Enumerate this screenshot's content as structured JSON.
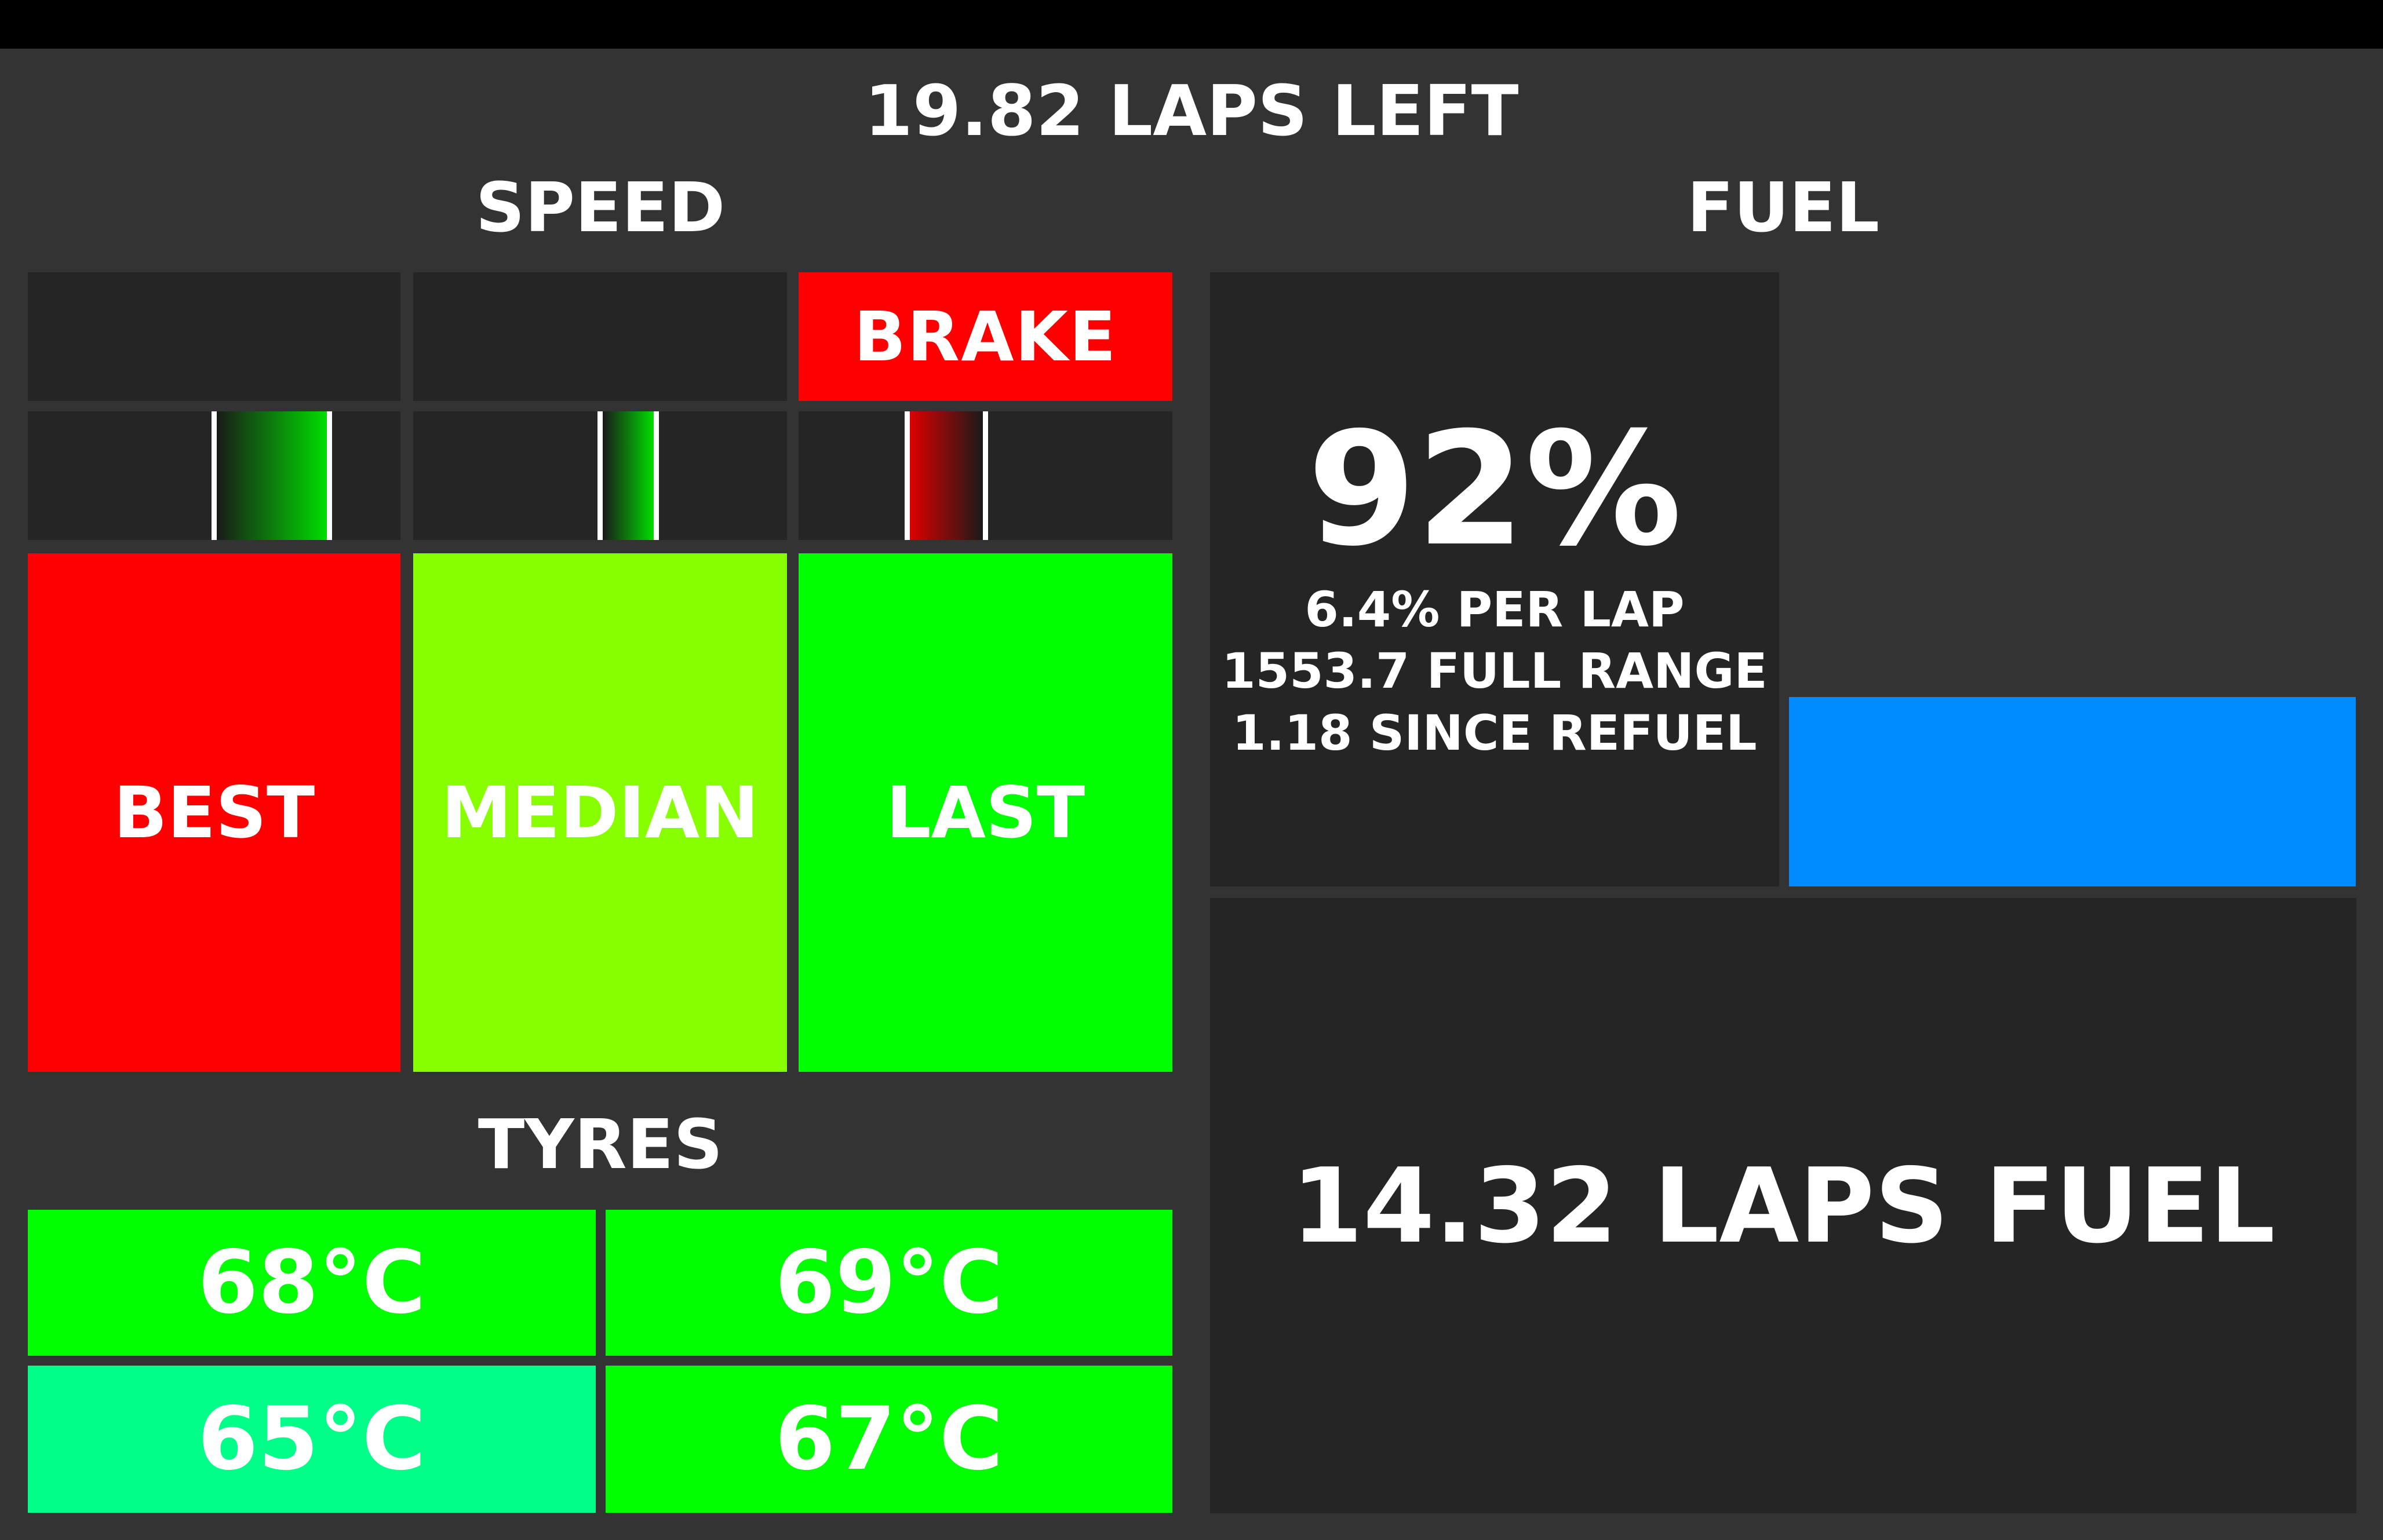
{
  "header": {
    "laps_left": "19.82 LAPS LEFT"
  },
  "speed": {
    "title": "SPEED",
    "indicators": [
      {
        "label": "",
        "color": "#252525"
      },
      {
        "label": "",
        "color": "#252525"
      },
      {
        "label": "BRAKE",
        "color": "#ff0000"
      }
    ],
    "delta_bars": [
      {
        "name": "best",
        "fill_color": "#00dd00",
        "direction": "positive",
        "level": 0.62
      },
      {
        "name": "median",
        "fill_color": "#00dd00",
        "direction": "positive",
        "level": 0.3
      },
      {
        "name": "last",
        "fill_color": "#dd0000",
        "direction": "negative",
        "level": 0.42
      }
    ],
    "boxes": [
      {
        "label": "BEST",
        "color": "#ff0000"
      },
      {
        "label": "MEDIAN",
        "color": "#88ff00"
      },
      {
        "label": "LAST",
        "color": "#00ff00"
      }
    ]
  },
  "tyres": {
    "title": "TYRES",
    "values": [
      {
        "label": "68°C",
        "color": "#00ff00"
      },
      {
        "label": "69°C",
        "color": "#00ff00"
      },
      {
        "label": "65°C",
        "color": "#00ff88"
      },
      {
        "label": "67°C",
        "color": "#00ff00"
      }
    ]
  },
  "fuel": {
    "title": "FUEL",
    "percent": "92%",
    "per_lap": "6.4% PER LAP",
    "full_range": "1553.7 FULL RANGE",
    "since_refuel": "1.18 SINCE REFUEL",
    "level_fraction": 0.12,
    "level_color": "#008cff",
    "laps_fuel": "14.32 LAPS FUEL"
  }
}
